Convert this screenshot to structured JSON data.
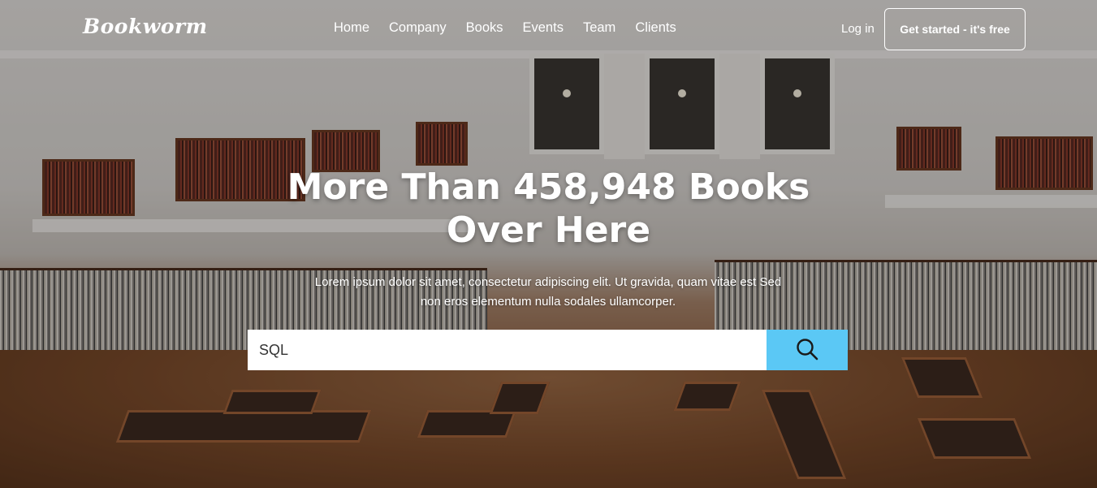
{
  "brand": {
    "logo_text": "Bookworm"
  },
  "nav": {
    "items": [
      {
        "label": "Home"
      },
      {
        "label": "Company"
      },
      {
        "label": "Books"
      },
      {
        "label": "Events"
      },
      {
        "label": "Team"
      },
      {
        "label": "Clients"
      }
    ],
    "login_label": "Log in",
    "cta_label": "Get started - it's free"
  },
  "hero": {
    "title_line1": "More Than 458,948 Books",
    "title_line2": "Over Here",
    "subtitle": "Lorem ipsum dolor sit amet, consectetur adipiscing elit. Ut gravida, quam vitae est Sed non eros elementum nulla sodales ullamcorper."
  },
  "search": {
    "value": "SQL",
    "button_icon": "search-icon"
  },
  "colors": {
    "accent": "#5bc8f5",
    "text": "#ffffff"
  }
}
